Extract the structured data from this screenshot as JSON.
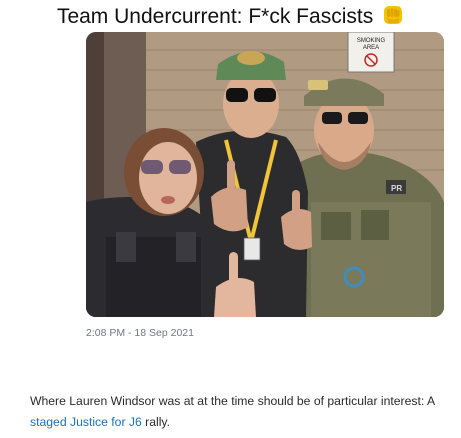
{
  "tweet": {
    "title": "Team Undercurrent: F*ck Fascists",
    "emoji_icon": "raised-fist-icon",
    "timestamp": "2:08 PM - 18 Sep 2021",
    "photo": {
      "sign_line1": "SMOKING",
      "sign_line2": "AREA",
      "patch_text": "PR"
    }
  },
  "article": {
    "text_before": "Where Lauren Windsor was at at the time should be of particular interest: A ",
    "link_text": "staged Justice for J6",
    "text_after": " rally."
  },
  "colors": {
    "link": "#1d6fb8",
    "timestamp": "#6f7780",
    "fist": "#f5c200"
  }
}
